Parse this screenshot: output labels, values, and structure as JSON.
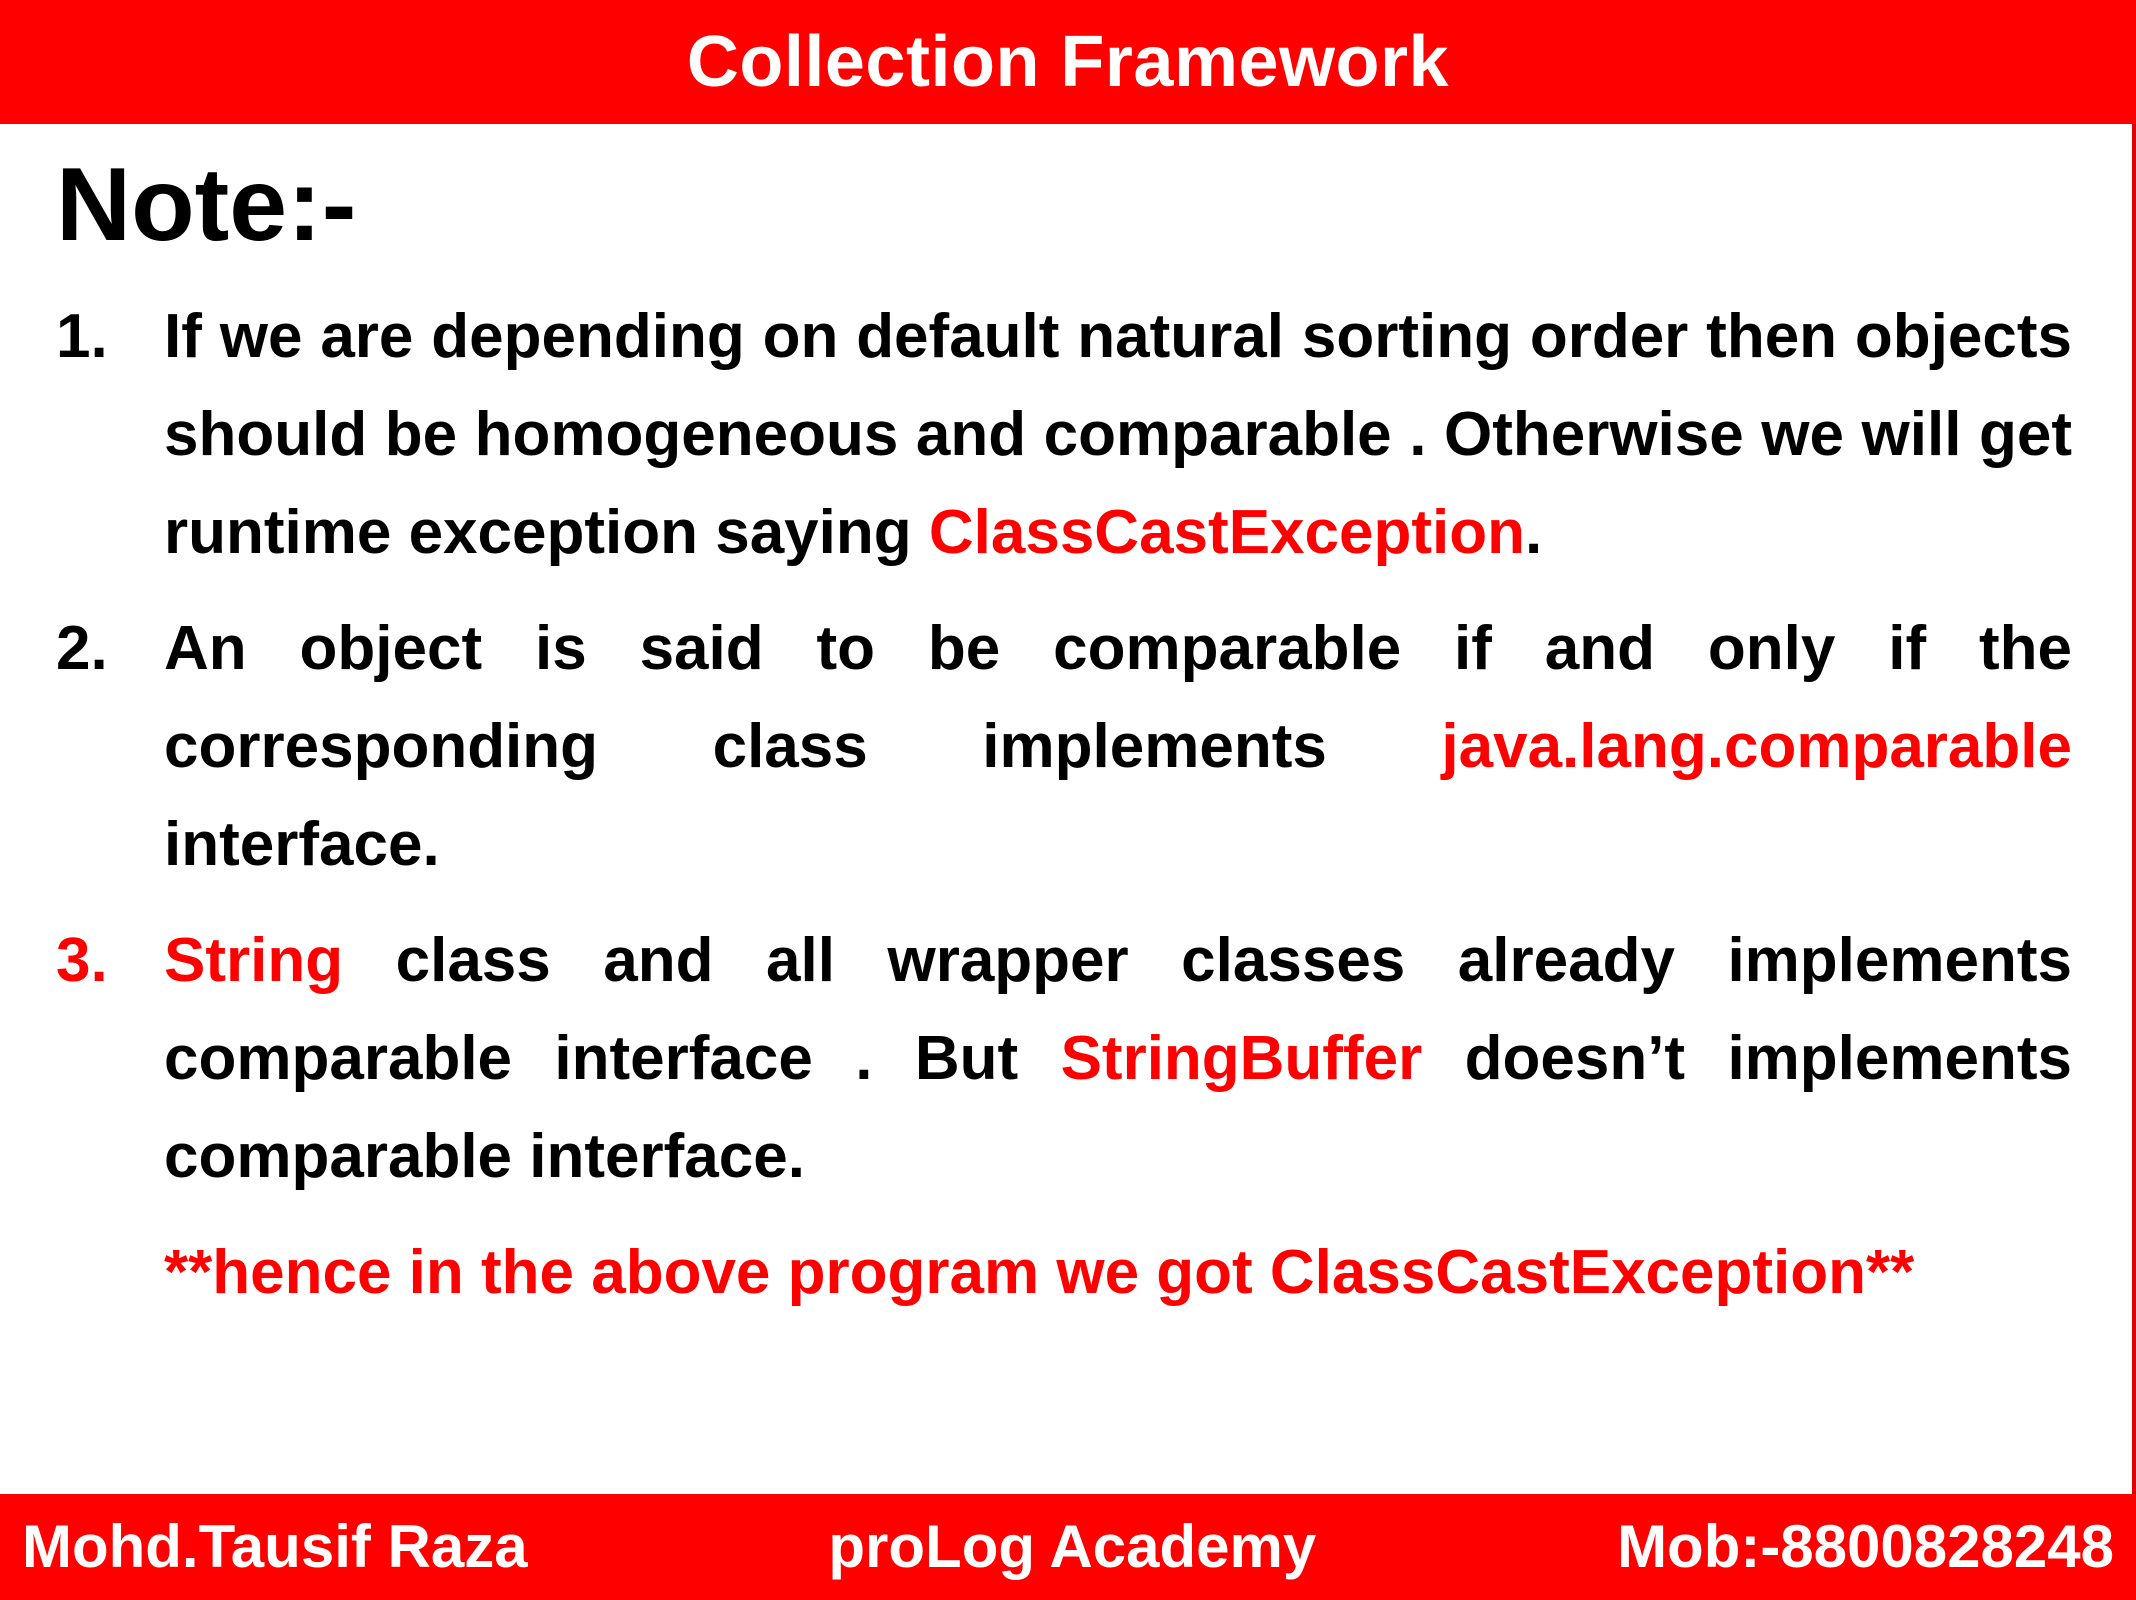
{
  "header": {
    "title": "Collection Framework"
  },
  "note": {
    "heading": "Note:-"
  },
  "points": [
    {
      "number": "1.",
      "text_before": "If we are depending on default natural sorting order then objects should be homogeneous and comparable . Otherwise we will get runtime exception saying ",
      "highlight": "ClassCastException",
      "text_after": "."
    },
    {
      "number": "2.",
      "text_before": "An object is said to be comparable if and only if the corresponding class implements ",
      "highlight": "java.lang.comparable",
      "text_after": " interface."
    },
    {
      "number": "3.",
      "highlight_start": "String",
      "text_middle": " class and all wrapper classes already implements comparable interface . But ",
      "highlight_mid": "StringBuffer",
      "text_after": " doesn’t implements comparable interface."
    }
  ],
  "hence_note": "**hence in the above program we got ClassCastException**",
  "footer": {
    "author": "Mohd.Tausif Raza",
    "academy": "proLog Academy",
    "mobile": "Mob:-8800828248"
  },
  "colors": {
    "accent": "#ff0000",
    "text": "#000000",
    "background": "#ffffff"
  }
}
